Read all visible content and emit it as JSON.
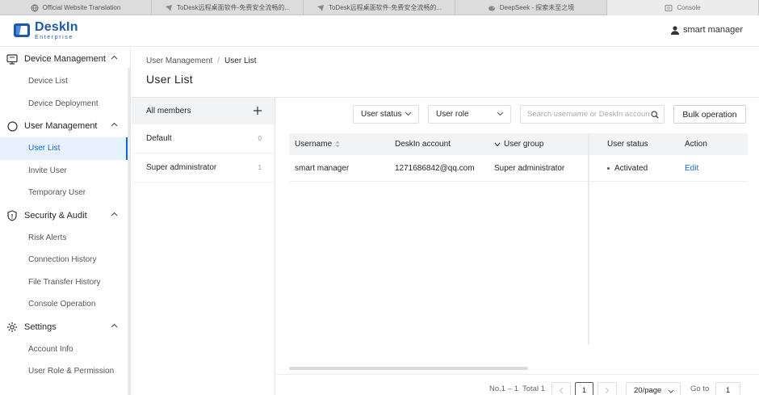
{
  "browser": {
    "tabs": [
      {
        "label": "Official Website Translation",
        "icon": "globe-icon"
      },
      {
        "label": "ToDesk远程桌面软件-免费安全流畅的...",
        "icon": "todesk-icon"
      },
      {
        "label": "ToDesk远程桌面软件-免费安全流畅的...",
        "icon": "todesk-icon"
      },
      {
        "label": "DeepSeek - 探索未至之境",
        "icon": "deepseek-icon"
      },
      {
        "label": "Console",
        "icon": "console-icon"
      }
    ]
  },
  "header": {
    "brand": "DeskIn",
    "brand_sub": "Enterprise",
    "user_name": "smart manager"
  },
  "sidebar": {
    "groups": [
      {
        "label": "Device Management",
        "icon": "monitor-icon",
        "items": [
          "Device List",
          "Device Deployment"
        ]
      },
      {
        "label": "User Management",
        "icon": "user-circle-icon",
        "items": [
          "User List",
          "Invite User",
          "Temporary User"
        ]
      },
      {
        "label": "Security & Audit",
        "icon": "shield-icon",
        "items": [
          "Risk Alerts",
          "Connection History",
          "File Transfer History",
          "Console Operation"
        ]
      },
      {
        "label": "Settings",
        "icon": "gear-icon",
        "items": [
          "Account Info",
          "User Role & Permission"
        ]
      }
    ],
    "active_item": "User List"
  },
  "breadcrumb": {
    "parent": "User Management",
    "separator": "/",
    "current": "User List"
  },
  "page_title": "User List",
  "member_groups": {
    "header": "All members",
    "items": [
      {
        "name": "Default",
        "count": "0"
      },
      {
        "name": "Super administrator",
        "count": "1"
      }
    ]
  },
  "filters": {
    "user_status": "User status",
    "user_role": "User role",
    "search_placeholder": "Search username or DeskIn account",
    "bulk_button": "Bulk operation"
  },
  "table": {
    "columns": [
      "Username",
      "DeskIn account",
      "User group",
      "User status",
      "Action"
    ],
    "rows": [
      {
        "username": "smart manager",
        "account": "1271686842@qq.com",
        "group": "Super administrator",
        "status": "Activated",
        "action": "Edit"
      }
    ]
  },
  "pagination": {
    "range": "No.1 – 1",
    "total": "Total 1",
    "current_page": "1",
    "page_size": "20/page",
    "goto_label": "Go to",
    "goto_value": "1"
  },
  "colors": {
    "accent": "#1668dc",
    "brand": "#1c5aa8",
    "active_bg": "#e8f2ff"
  }
}
